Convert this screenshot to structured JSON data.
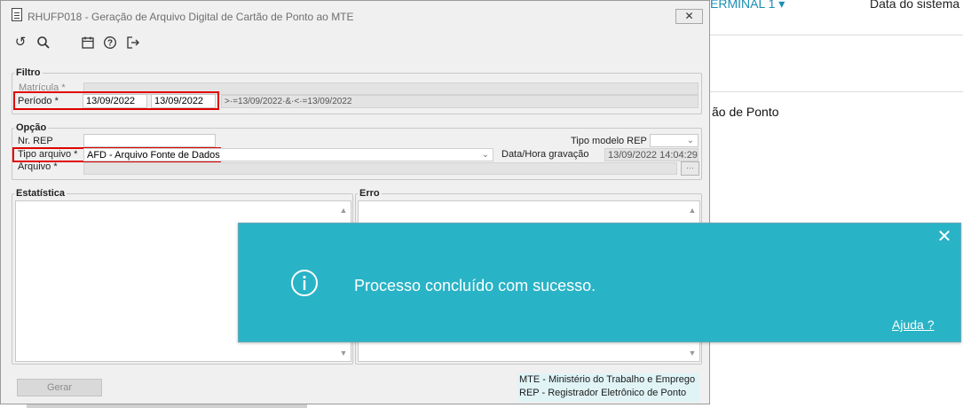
{
  "background": {
    "nav_left": "ERMINAL 1 ▾",
    "nav_right": "Data do sistema",
    "partial_text": "ão de Ponto"
  },
  "window": {
    "title": "RHUFP018 - Geração de Arquivo Digital de Cartão de Ponto ao MTE",
    "close_glyph": "✕"
  },
  "toolbar": {
    "undo_glyph": "↺",
    "search_glyph": "⚲",
    "calendar_glyph": "▦",
    "help_glyph": "?",
    "exit_glyph": "⇥"
  },
  "filtro": {
    "legend": "Filtro",
    "matricula_label": "Matrícula *",
    "periodo_label": "Período *",
    "periodo_inicio": "13/09/2022",
    "periodo_fim": "13/09/2022",
    "expressao": ">·=13/09/2022·&·<·=13/09/2022"
  },
  "opcao": {
    "legend": "Opção",
    "nr_rep_label": "Nr. REP",
    "tipo_modelo_label": "Tipo modelo REP",
    "tipo_arquivo_label": "Tipo arquivo *",
    "tipo_arquivo_value": "AFD - Arquivo Fonte de Dados",
    "data_hora_label": "Data/Hora gravação",
    "data_hora_value": "13/09/2022 14:04:29",
    "arquivo_label": "Arquivo *",
    "browse_glyph": "⋯"
  },
  "estatistica": {
    "legend": "Estatística"
  },
  "erro": {
    "legend": "Erro"
  },
  "footer": {
    "gerar_label": "Gerar",
    "legend_lines": [
      "MTE - Ministério do Trabalho e Emprego",
      "REP - Registrador Eletrônico de Ponto"
    ]
  },
  "notification": {
    "message": "Processo concluído com sucesso.",
    "help_link": "Ajuda ?",
    "close_glyph": "✕",
    "icon": "info-icon"
  }
}
